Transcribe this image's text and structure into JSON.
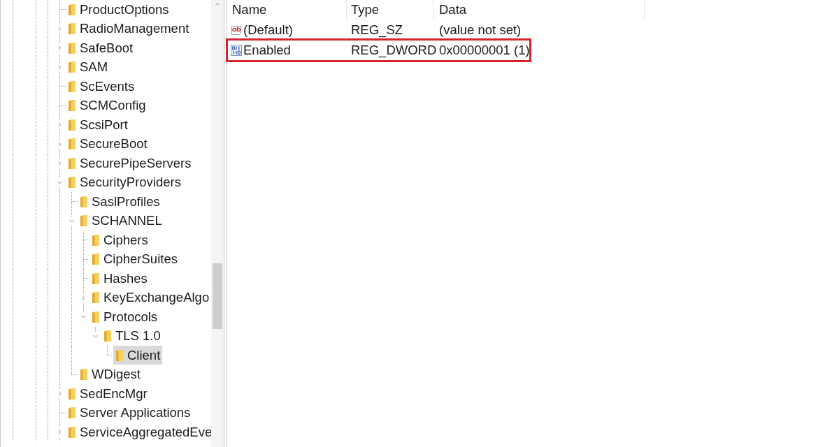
{
  "tree": {
    "items": [
      {
        "label": "ProductOptions",
        "selected": false
      },
      {
        "label": "RadioManagement",
        "expanded": false,
        "selected": false
      },
      {
        "label": "SafeBoot",
        "expanded": false,
        "selected": false
      },
      {
        "label": "SAM",
        "expanded": false,
        "selected": false
      },
      {
        "label": "ScEvents",
        "selected": false
      },
      {
        "label": "SCMConfig",
        "selected": false
      },
      {
        "label": "ScsiPort",
        "expanded": false,
        "selected": false
      },
      {
        "label": "SecureBoot",
        "expanded": false,
        "selected": false
      },
      {
        "label": "SecurePipeServers",
        "expanded": false,
        "selected": false
      },
      {
        "label": "SecurityProviders",
        "expanded": true,
        "selected": false,
        "children": [
          {
            "label": "SaslProfiles",
            "selected": false
          },
          {
            "label": "SCHANNEL",
            "expanded": true,
            "selected": false,
            "children": [
              {
                "label": "Ciphers",
                "selected": false
              },
              {
                "label": "CipherSuites",
                "selected": false
              },
              {
                "label": "Hashes",
                "selected": false
              },
              {
                "label": "KeyExchangeAlgo",
                "expanded": false,
                "selected": false
              },
              {
                "label": "Protocols",
                "expanded": true,
                "selected": false,
                "children": [
                  {
                    "label": "TLS 1.0",
                    "expanded": true,
                    "selected": false,
                    "children": [
                      {
                        "label": "Client",
                        "selected": true
                      }
                    ]
                  }
                ]
              }
            ]
          },
          {
            "label": "WDigest",
            "selected": false
          }
        ]
      },
      {
        "label": "SedEncMgr",
        "expanded": false,
        "selected": false
      },
      {
        "label": "Server Applications",
        "selected": false
      },
      {
        "label": "ServiceAggregatedEve",
        "expanded": false,
        "selected": false
      }
    ]
  },
  "values": {
    "columns": [
      "Name",
      "Type",
      "Data"
    ],
    "rows": [
      {
        "kind": "string",
        "name": "(Default)",
        "type": "REG_SZ",
        "data": "(value not set)",
        "highlighted": false
      },
      {
        "kind": "dword",
        "name": "Enabled",
        "type": "REG_DWORD",
        "data": "0x00000001 (1)",
        "highlighted": true
      }
    ]
  }
}
